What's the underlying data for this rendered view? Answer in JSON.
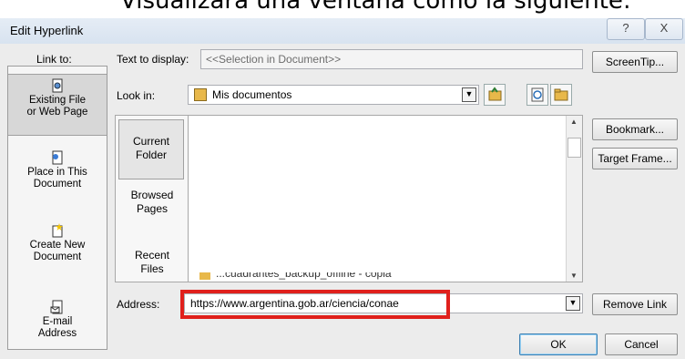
{
  "caption": "Visualizará una ventana como la siguiente:",
  "dialog": {
    "title": "Edit Hyperlink",
    "help_glyph": "?",
    "close_glyph": "X"
  },
  "link_to": {
    "label": "Link to:",
    "items": [
      {
        "line1": "Existing File",
        "line2": "or Web Page",
        "icon": "existing-file-icon"
      },
      {
        "line1": "Place in This",
        "line2": "Document",
        "icon": "place-in-document-icon"
      },
      {
        "line1": "Create New",
        "line2": "Document",
        "icon": "new-document-icon"
      },
      {
        "line1": "E-mail",
        "line2": "Address",
        "icon": "email-icon"
      }
    ]
  },
  "text_to_display": {
    "label": "Text to display:",
    "value": "<<Selection in Document>>"
  },
  "look_in": {
    "label": "Look in:",
    "value": "Mis documentos"
  },
  "folders": [
    {
      "line1": "Current",
      "line2": "Folder"
    },
    {
      "line1": "Browsed",
      "line2": "Pages"
    },
    {
      "line1": "Recent",
      "line2": "Files"
    }
  ],
  "file_partial": "...cuadrantes_backup_offline - copia",
  "address": {
    "label": "Address:",
    "value": "https://www.argentina.gob.ar/ciencia/conae"
  },
  "buttons": {
    "screentip": "ScreenTip...",
    "bookmark": "Bookmark...",
    "target_frame": "Target Frame...",
    "remove_link": "Remove Link",
    "ok": "OK",
    "cancel": "Cancel"
  },
  "colors": {
    "highlight": "#e0201c",
    "selected_bg": "#d7d7d7"
  }
}
